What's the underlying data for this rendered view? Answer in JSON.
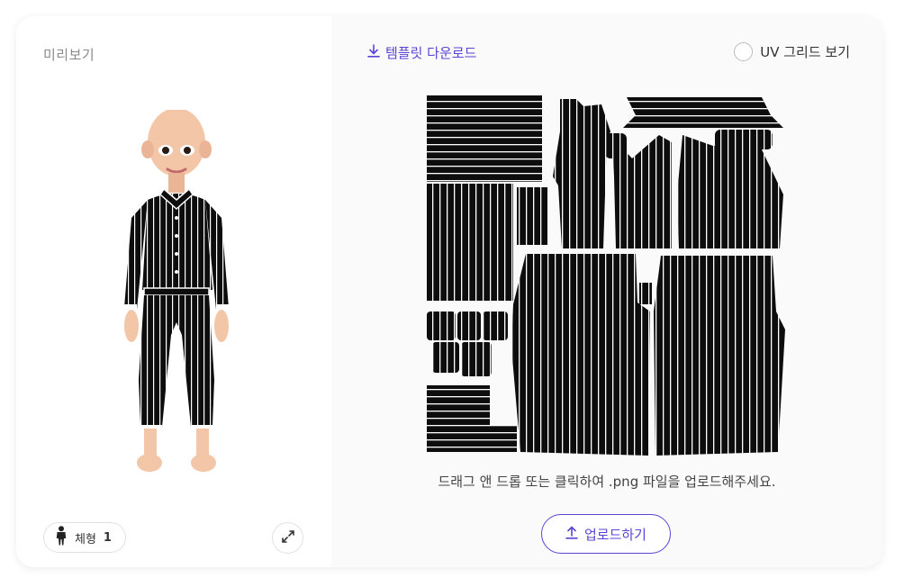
{
  "preview": {
    "title": "미리보기",
    "body_type_label": "체형",
    "body_type_value": "1"
  },
  "toolbar": {
    "download_label": "템플릿 다운로드",
    "uv_grid_label": "UV 그리드 보기",
    "uv_grid_checked": false
  },
  "upload": {
    "hint": "드래그 앤 드롭 또는 클릭하여 .png 파일을 업로드해주세요.",
    "button_label": "업로드하기"
  },
  "colors": {
    "accent": "#5b43d6",
    "fabric": "#0d0d0d",
    "stripe": "#ffffff",
    "skin": "#f3c6a8"
  },
  "icons": {
    "download": "download-icon",
    "upload": "upload-icon",
    "body": "person-icon",
    "expand": "expand-icon"
  }
}
